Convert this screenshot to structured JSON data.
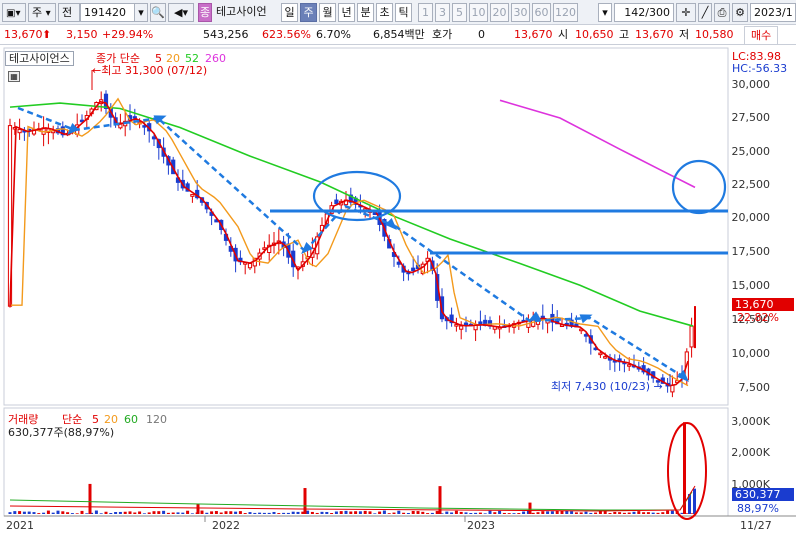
{
  "toolbar": {
    "market": "주",
    "prev_label": "전",
    "code": "191420",
    "stock_name": "테고사이언",
    "periods": [
      "일",
      "주",
      "월",
      "년",
      "분",
      "초",
      "틱"
    ],
    "active_period": "주",
    "intervals": [
      "1",
      "3",
      "5",
      "10",
      "20",
      "30",
      "60",
      "120"
    ],
    "count": "142",
    "count_total": "/300",
    "date": "2023/1"
  },
  "quote": {
    "price": "13,670",
    "change": "3,150",
    "change_pct": "+29.94%",
    "volume": "543,256",
    "volume_ratio": "623.56%",
    "turnover_rate": "6.70%",
    "amount": "6,854백만",
    "hoga_label": "호가",
    "hoga_value": "0",
    "current_price": "13,670",
    "open_label": "시",
    "open": "10,650",
    "high_label": "고",
    "high": "13,670",
    "low_label": "저",
    "low": "10,580",
    "buy_label": "매수"
  },
  "chart": {
    "stock_tag": "테고사이언스",
    "ma_title": "종가 단순",
    "ma_periods": [
      "5",
      "20",
      "52",
      "260"
    ],
    "max_label": "최고 31,300 (07/12)",
    "min_label": "최저 7,430 (10/23)",
    "lc_label": "LC:83.98",
    "hc_label": "HC:-56.33",
    "last_price": "13,670",
    "last_pct": "22.82%",
    "y_ticks": [
      "30,000",
      "27,500",
      "25,000",
      "22,500",
      "20,000",
      "17,500",
      "15,000",
      "12,500",
      "10,000",
      "7,500"
    ],
    "x_labels": [
      "2021",
      "2022",
      "2023",
      "11/27"
    ],
    "colors": {
      "up": "#e10000",
      "down": "#1a3ccf",
      "ma5": "#e10000",
      "ma20": "#f39a1c",
      "ma52": "#22cc22",
      "ma260": "#dd33dd",
      "annot": "#1f7ae0"
    }
  },
  "volume_panel": {
    "title": "거래량",
    "ma_title": "단순",
    "ma_periods": [
      "5",
      "20",
      "60",
      "120"
    ],
    "value_label": "630,377주(88,97%)",
    "y_ticks": [
      "3,000K",
      "2,000K",
      "1,000K"
    ],
    "last_value": "630,377",
    "last_pct": "88,97%"
  }
}
